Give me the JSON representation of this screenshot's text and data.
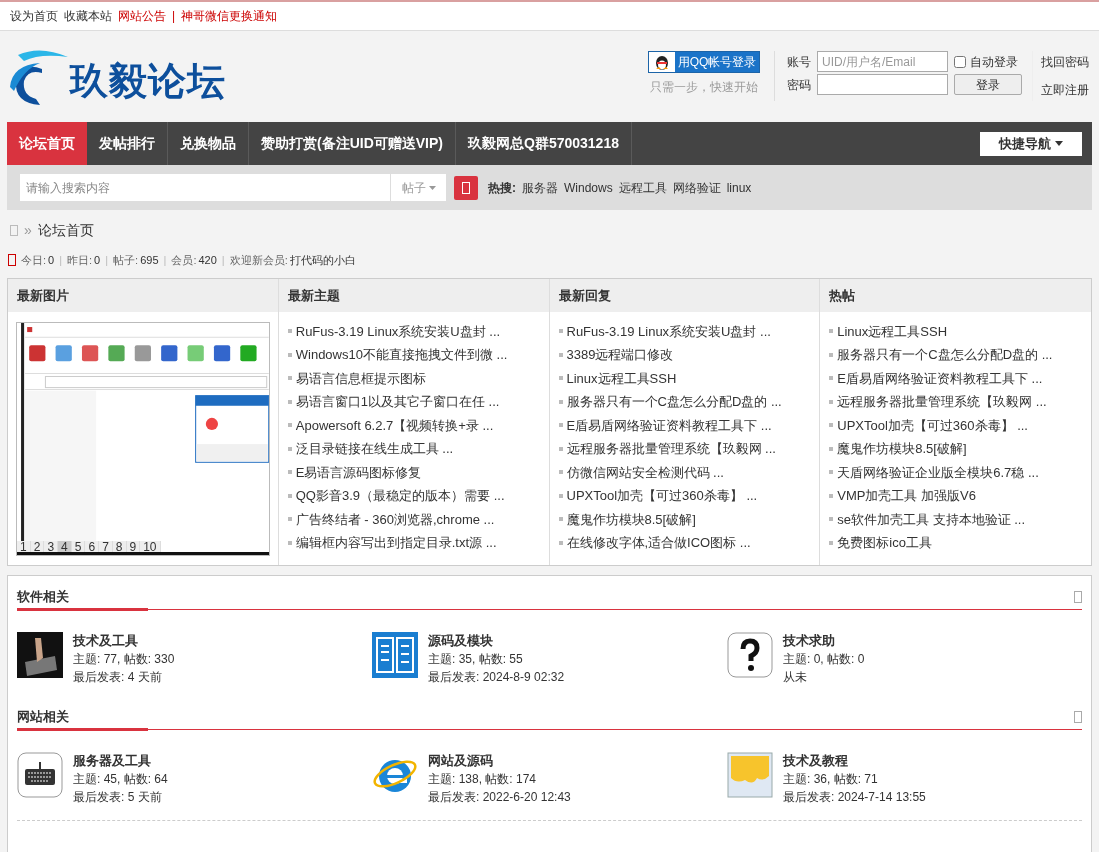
{
  "top_links": [
    {
      "text": "设为首页",
      "kind": "plain"
    },
    {
      "text": "收藏本站",
      "kind": "plain"
    },
    {
      "text": "网站公告",
      "kind": "notice"
    },
    {
      "text": "|",
      "kind": "separator"
    },
    {
      "text": "神哥微信更换通知",
      "kind": "notice"
    }
  ],
  "logo": {
    "text": "玖毅论坛"
  },
  "login": {
    "qq_button": "用QQ帐号登录",
    "qq_hint": "只需一步，快速开始",
    "account_label": "账号",
    "account_placeholder": "UID/用户名/Email",
    "password_label": "密码",
    "auto_login": {
      "label": "自动登录",
      "checked": false
    },
    "login_button": "登录",
    "links": [
      "找回密码",
      "立即注册"
    ]
  },
  "nav": {
    "items": [
      {
        "label": "论坛首页",
        "selected": true
      },
      {
        "label": "发帖排行",
        "selected": false
      },
      {
        "label": "兑换物品",
        "selected": false
      },
      {
        "label": "赞助打赏(备注UID可赠送VIP)",
        "selected": false
      },
      {
        "label": "玖毅网总Q群570031218",
        "selected": false
      }
    ],
    "quick_nav": "快捷导航"
  },
  "search": {
    "placeholder": "请输入搜索内容",
    "type": "帖子",
    "hot_label": "热搜:",
    "hot_words": [
      "服务器",
      "Windows",
      "远程工具",
      "网络验证",
      "linux"
    ]
  },
  "breadcrumb": {
    "separator": "»",
    "items": [
      "论坛首页"
    ]
  },
  "stats": {
    "separator": "|",
    "items": [
      {
        "label": "今日:",
        "value": "0"
      },
      {
        "label": "昨日:",
        "value": "0"
      },
      {
        "label": "帖子:",
        "value": "695"
      },
      {
        "label": "会员:",
        "value": "420"
      },
      {
        "label": "欢迎新会员:",
        "value": "打代码的小白"
      }
    ]
  },
  "panels": [
    {
      "title": "最新图片",
      "kind": "image",
      "pages": [
        {
          "label": "1",
          "selected": false
        },
        {
          "label": "2",
          "selected": false
        },
        {
          "label": "3",
          "selected": false
        },
        {
          "label": "4",
          "selected": true
        },
        {
          "label": "5",
          "selected": false
        },
        {
          "label": "6",
          "selected": false
        },
        {
          "label": "7",
          "selected": false
        },
        {
          "label": "8",
          "selected": false
        },
        {
          "label": "9",
          "selected": false
        },
        {
          "label": "10",
          "selected": false
        }
      ]
    },
    {
      "title": "最新主题",
      "kind": "list",
      "items": [
        "RuFus-3.19 Linux系统安装U盘封 ...",
        "Windows10不能直接拖拽文件到微 ...",
        "易语言信息框提示图标",
        "易语言窗口1以及其它子窗口在任 ...",
        "Apowersoft 6.2.7【视频转换+录 ...",
        "泛目录链接在线生成工具 ...",
        "E易语言源码图标修复",
        "QQ影音3.9（最稳定的版本）需要 ...",
        "广告终结者 - 360浏览器,chrome ...",
        "编辑框内容写出到指定目录.txt源 ..."
      ]
    },
    {
      "title": "最新回复",
      "kind": "list",
      "items": [
        "RuFus-3.19 Linux系统安装U盘封 ...",
        "3389远程端口修改",
        "Linux远程工具SSH",
        "服务器只有一个C盘怎么分配D盘的 ...",
        "E盾易盾网络验证资料教程工具下 ...",
        "远程服务器批量管理系统【玖毅网 ...",
        "仿微信网站安全检测代码 ...",
        "UPXTool加壳【可过360杀毒】 ...",
        "魔鬼作坊模块8.5[破解]",
        "在线修改字体,适合做ICO图标 ..."
      ]
    },
    {
      "title": "热帖",
      "kind": "list",
      "items": [
        "Linux远程工具SSH",
        "服务器只有一个C盘怎么分配D盘的 ...",
        "E盾易盾网络验证资料教程工具下 ...",
        "远程服务器批量管理系统【玖毅网 ...",
        "UPXTool加壳【可过360杀毒】 ...",
        "魔鬼作坊模块8.5[破解]",
        "天盾网络验证企业版全模块6.7稳 ...",
        "VMP加壳工具 加强版V6",
        "se软件加壳工具 支持本地验证 ...",
        "免费图标ico工具"
      ]
    }
  ],
  "sections": [
    {
      "title": "软件相关",
      "forums": [
        {
          "kind": "hand",
          "name": "技术及工具",
          "stats": "主题: 77, 帖数: 330",
          "last": "最后发表: 4 天前"
        },
        {
          "kind": "book",
          "name": "源码及模块",
          "stats": "主题: 35, 帖数: 55",
          "last": "最后发表: 2024-8-9 02:32"
        },
        {
          "kind": "question",
          "name": "技术求助",
          "stats": "主题: 0, 帖数: 0",
          "last": "从未"
        }
      ]
    },
    {
      "title": "网站相关",
      "forums": [
        {
          "kind": "keyboard",
          "name": "服务器及工具",
          "stats": "主题: 45, 帖数: 64",
          "last": "最后发表: 5 天前"
        },
        {
          "kind": "browser",
          "name": "网站及源码",
          "stats": "主题: 138, 帖数: 174",
          "last": "最后发表: 2022-6-20 12:43"
        },
        {
          "kind": "note",
          "name": "技术及教程",
          "stats": "主题: 36, 帖数: 71",
          "last": "最后发表: 2024-7-14 13:55"
        }
      ]
    }
  ]
}
